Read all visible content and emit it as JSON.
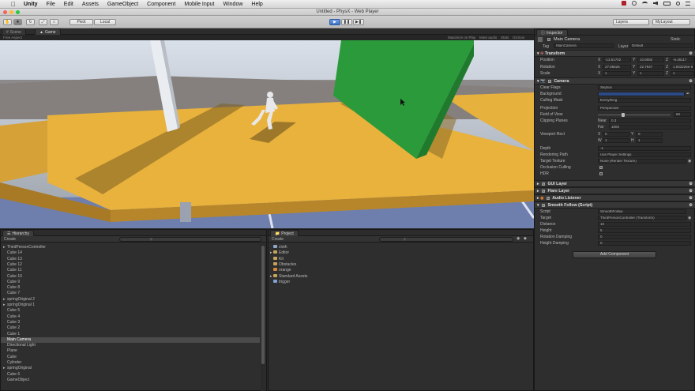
{
  "menubar": {
    "app": "Unity",
    "items": [
      "File",
      "Edit",
      "Assets",
      "GameObject",
      "Component",
      "Mobile Input",
      "Window",
      "Help"
    ]
  },
  "window": {
    "title": "Untitled - PhysX - Web Player"
  },
  "toolbar": {
    "pivot": "Pivot",
    "local": "Local",
    "layers": "Layers",
    "layout": "MyLayout"
  },
  "tabs": {
    "scene": "Scene",
    "game": "Game",
    "inspector": "Inspector",
    "hierarchy": "Hierarchy",
    "project": "Project"
  },
  "gamebar": {
    "aspect": "Free Aspect",
    "options": [
      "Maximize on Play",
      "Mute audio",
      "Stats",
      "Gizmos"
    ]
  },
  "hierarchy": {
    "create": "Create",
    "items": [
      {
        "label": "ThirdPersonController",
        "fold": true,
        "indent": 0
      },
      {
        "label": "Cube 14",
        "indent": 0
      },
      {
        "label": "Cube 13",
        "indent": 0
      },
      {
        "label": "Cube 12",
        "indent": 0
      },
      {
        "label": "Cube 11",
        "indent": 0
      },
      {
        "label": "Cube 10",
        "indent": 0
      },
      {
        "label": "Cube 9",
        "indent": 0
      },
      {
        "label": "Cube 8",
        "indent": 0
      },
      {
        "label": "Cube 7",
        "indent": 0
      },
      {
        "label": "springOriginal 2",
        "fold": true,
        "indent": 0
      },
      {
        "label": "springOriginal 1",
        "fold": true,
        "indent": 0
      },
      {
        "label": "Cube 5",
        "indent": 0
      },
      {
        "label": "Cube 4",
        "indent": 0
      },
      {
        "label": "Cube 3",
        "indent": 0
      },
      {
        "label": "Cube 2",
        "indent": 0
      },
      {
        "label": "Cube 1",
        "indent": 0
      },
      {
        "label": "Main Camera",
        "indent": 0,
        "selected": true
      },
      {
        "label": "Directional Light",
        "indent": 0
      },
      {
        "label": "Plane",
        "indent": 0
      },
      {
        "label": "Cube",
        "indent": 0
      },
      {
        "label": "Cylinder",
        "indent": 0
      },
      {
        "label": "springOriginal",
        "fold": true,
        "indent": 0
      },
      {
        "label": "Cube 6",
        "indent": 0
      },
      {
        "label": "GameObject",
        "indent": 0
      }
    ]
  },
  "project": {
    "create": "Create",
    "items": [
      {
        "label": "cloth",
        "icon": "cloth-icon"
      },
      {
        "label": "Editor",
        "icon": "folder-icon",
        "fold": true
      },
      {
        "label": "Kit",
        "icon": "folder-icon"
      },
      {
        "label": "Obstacles",
        "icon": "folder-icon"
      },
      {
        "label": "orange",
        "icon": "material-icon"
      },
      {
        "label": "Standard Assets",
        "icon": "folder-icon",
        "fold": true
      },
      {
        "label": "trigger",
        "icon": "prefab-icon"
      }
    ]
  },
  "inspector": {
    "object_name": "Main Camera",
    "static": "Static",
    "tag_label": "Tag",
    "tag": "MainCamera",
    "layer_label": "Layer",
    "layer": "Default",
    "transform": {
      "title": "Transform",
      "position_label": "Position",
      "position": {
        "x": "-13.51702",
        "y": "10.8082",
        "z": "-6.46117"
      },
      "rotation_label": "Rotation",
      "rotation": {
        "x": "27.86626",
        "y": "22.7947",
        "z": "1.933226e-6"
      },
      "scale_label": "Scale",
      "scale": {
        "x": "1",
        "y": "1",
        "z": "1"
      }
    },
    "camera": {
      "title": "Camera",
      "clear_flags_label": "Clear Flags",
      "clear_flags": "Skybox",
      "background_label": "Background",
      "culling_mask_label": "Culling Mask",
      "culling_mask": "Everything",
      "projection_label": "Projection",
      "projection": "Perspective",
      "fov_label": "Field of View",
      "fov": "60",
      "clipping_label": "Clipping Planes",
      "near_label": "Near",
      "near": "0.3",
      "far_label": "Far",
      "far": "1000",
      "viewport_label": "Viewport Rect",
      "vp_x": "0",
      "vp_y": "0",
      "vp_w": "1",
      "vp_h": "1",
      "depth_label": "Depth",
      "depth": "-1",
      "rendering_path_label": "Rendering Path",
      "rendering_path": "Use Player Settings",
      "target_texture_label": "Target Texture",
      "target_texture": "None (Render Texture)",
      "occlusion_label": "Occlusion Culling",
      "hdr_label": "HDR"
    },
    "gui_layer": "GUI Layer",
    "flare_layer": "Flare Layer",
    "audio_listener": "Audio Listener",
    "smooth_follow": {
      "title": "Smooth Follow (Script)",
      "script_label": "Script",
      "script": "SmoothFollow",
      "target_label": "Target",
      "target": "ThirdPersonController (Transform)",
      "distance_label": "Distance",
      "distance": "10",
      "height_label": "Height",
      "height": "5",
      "rot_damp_label": "Rotation Damping",
      "rot_damp": "0",
      "height_damp_label": "Height Damping",
      "height_damp": "0"
    },
    "add_component": "Add Component"
  },
  "colors": {
    "accent": "#3f72c4",
    "selection": "#4a4a4a",
    "ground": "#e3a93a",
    "green_wall": "#2a9a3b"
  }
}
